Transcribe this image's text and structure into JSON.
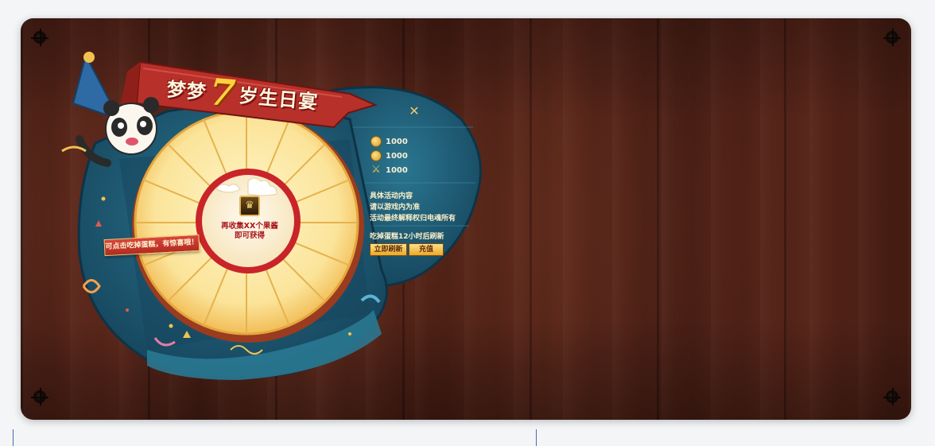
{
  "banner": {
    "title_prefix": "梦梦",
    "title_number": "7",
    "title_suffix": "岁生日宴"
  },
  "close": {
    "label": "✕"
  },
  "stats": [
    {
      "icon": "gold-coin-icon",
      "value": "1000"
    },
    {
      "icon": "gold-coin-icon",
      "value": "1000"
    },
    {
      "icon": "sword-icon",
      "value": "1000"
    }
  ],
  "rules": {
    "line1": "具体活动内容",
    "line2": "请以游戏内为准",
    "line3": "活动最终解释权归电魂所有"
  },
  "refresh_note": "吃掉蛋糕12小时后刷新",
  "buttons": {
    "refresh": "立即刷新",
    "recharge": "充值"
  },
  "hint": "可点击吃掉蛋糕，有惊喜哦！",
  "cake_center": {
    "line1": "再收集XX个果酱",
    "line2": "即可获得"
  },
  "colors": {
    "wood": "#4f2318",
    "panel_teal": "#1f5d78",
    "ribbon_red": "#b8302a",
    "cake_cream": "#fbe9a6",
    "gold": "#f0c356"
  }
}
